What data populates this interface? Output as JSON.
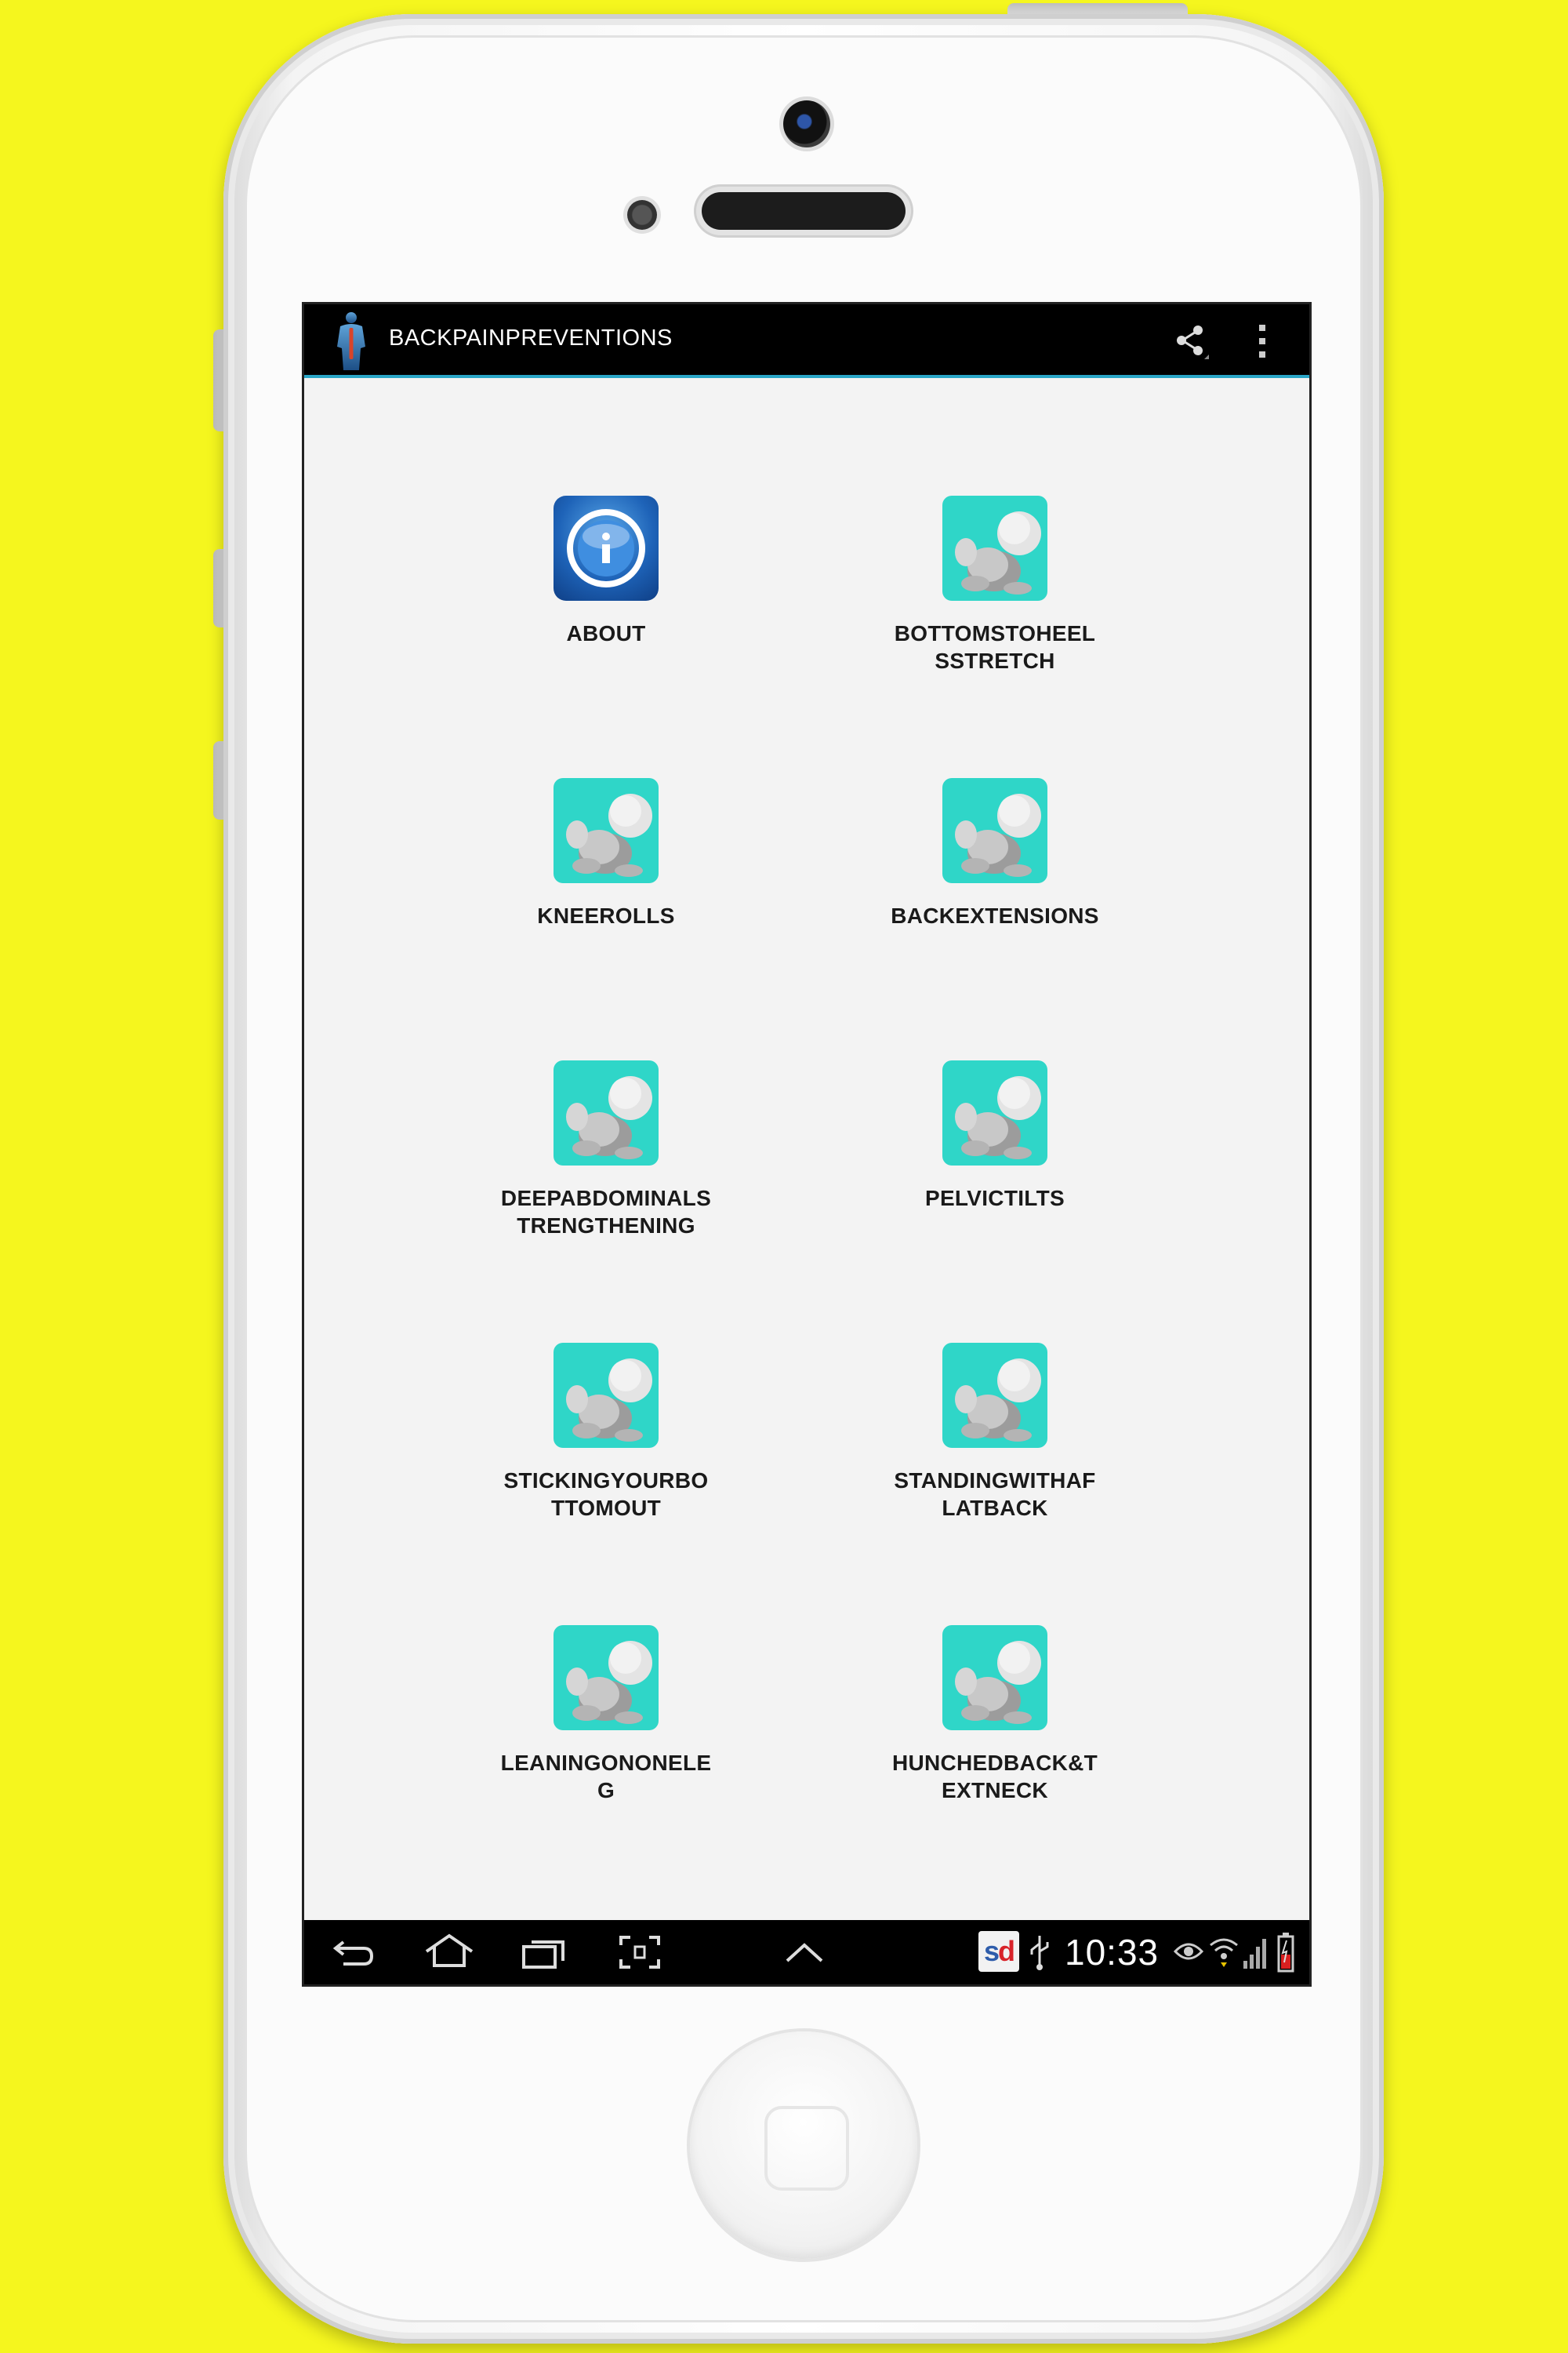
{
  "app": {
    "title": "BACKPAINPREVENTIONS",
    "accent_color": "#2aa6c7",
    "tile_color": "#2fd6c8"
  },
  "action_bar": {
    "icons": [
      "spine-app-icon",
      "share-icon",
      "overflow-menu-icon"
    ]
  },
  "menu": {
    "items": [
      {
        "label": "ABOUT",
        "icon": "info-icon"
      },
      {
        "label": "BOTTOMSTOHEEL\nSSTRETCH",
        "icon": "figure-stretch-icon"
      },
      {
        "label": "KNEEROLLS",
        "icon": "figure-stretch-icon"
      },
      {
        "label": "BACKEXTENSIONS",
        "icon": "figure-stretch-icon"
      },
      {
        "label": "DEEPABDOMINALS\nTRENGTHENING",
        "icon": "figure-stretch-icon"
      },
      {
        "label": "PELVICTILTS",
        "icon": "figure-stretch-icon"
      },
      {
        "label": "STICKINGYOURBO\nTTOMOUT",
        "icon": "figure-stretch-icon"
      },
      {
        "label": "STANDINGWITHAF\nLATBACK",
        "icon": "figure-stretch-icon"
      },
      {
        "label": "LEANINGONONELE\nG",
        "icon": "figure-stretch-icon"
      },
      {
        "label": "HUNCHEDBACK&T\nEXTNECK",
        "icon": "figure-stretch-icon"
      }
    ]
  },
  "status_bar": {
    "sd_text_s": "s",
    "sd_text_d": "d",
    "time": "10:33",
    "icons": [
      "back-icon",
      "home-icon",
      "recent-apps-icon",
      "screenshot-icon",
      "up-arrow-icon",
      "usb-icon",
      "eye-icon",
      "wifi-icon",
      "signal-icon",
      "battery-icon"
    ]
  }
}
